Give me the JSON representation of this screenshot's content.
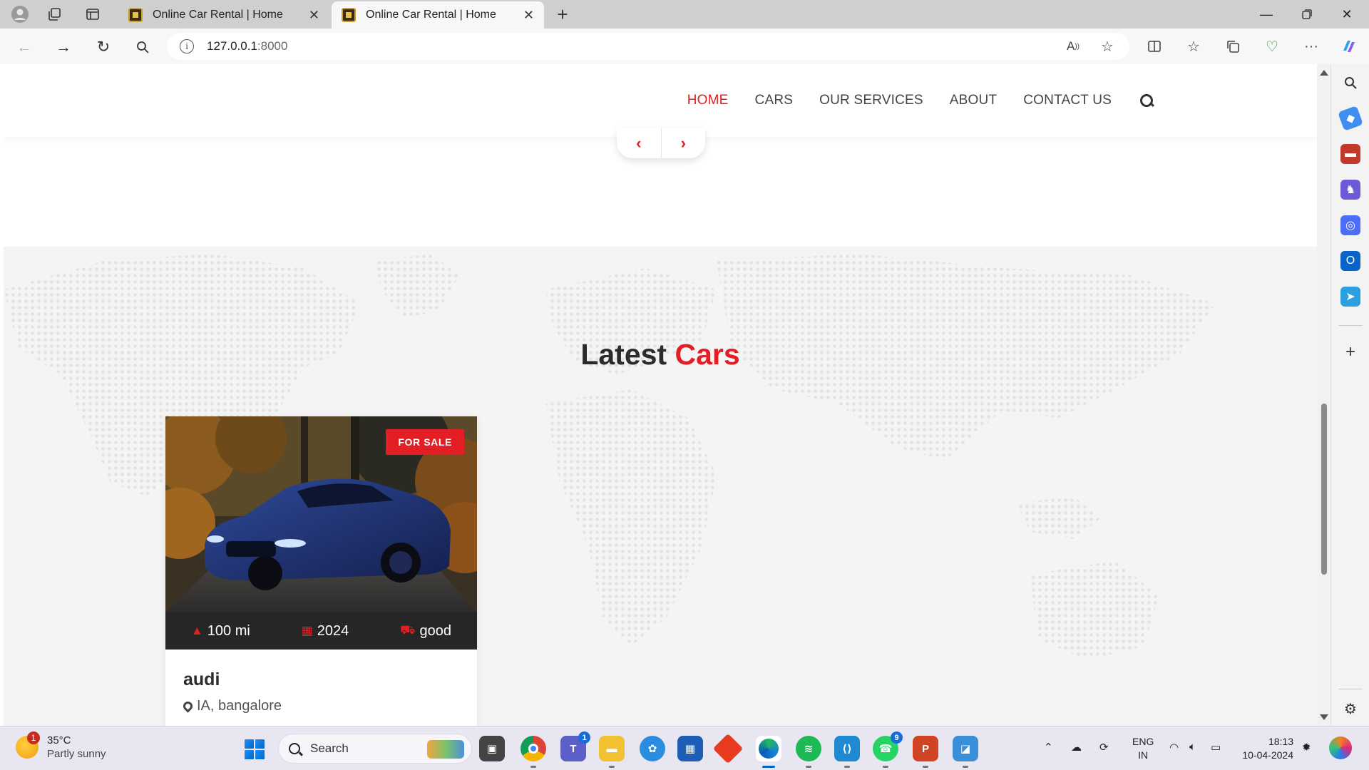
{
  "browser": {
    "tabs": [
      {
        "title": "Online Car Rental | Home",
        "active": false
      },
      {
        "title": "Online Car Rental | Home",
        "active": true
      }
    ],
    "address": {
      "host": "127.0.0.1",
      "port": ":8000"
    }
  },
  "site": {
    "menu": [
      {
        "label": "HOME",
        "active": true
      },
      {
        "label": "CARS",
        "active": false
      },
      {
        "label": "OUR SERVICES",
        "active": false
      },
      {
        "label": "ABOUT",
        "active": false
      },
      {
        "label": "CONTACT US",
        "active": false
      }
    ],
    "section": {
      "title_plain": "Latest",
      "title_accent": "Cars"
    },
    "car": {
      "badge": "FOR SALE",
      "mileage": "100 mi",
      "year": "2024",
      "condition": "good",
      "name": "audi",
      "location": "IA, bangalore"
    },
    "colors": {
      "accent": "#e31e24",
      "dark": "#262626"
    }
  },
  "taskbar": {
    "weather": {
      "temp": "35°C",
      "condition": "Partly sunny",
      "alerts": "1"
    },
    "search_label": "Search",
    "teams_badge": "1",
    "whatsapp_badge": "9",
    "language": {
      "line1": "ENG",
      "line2": "IN"
    },
    "clock": {
      "time": "18:13",
      "date": "10-04-2024"
    }
  }
}
